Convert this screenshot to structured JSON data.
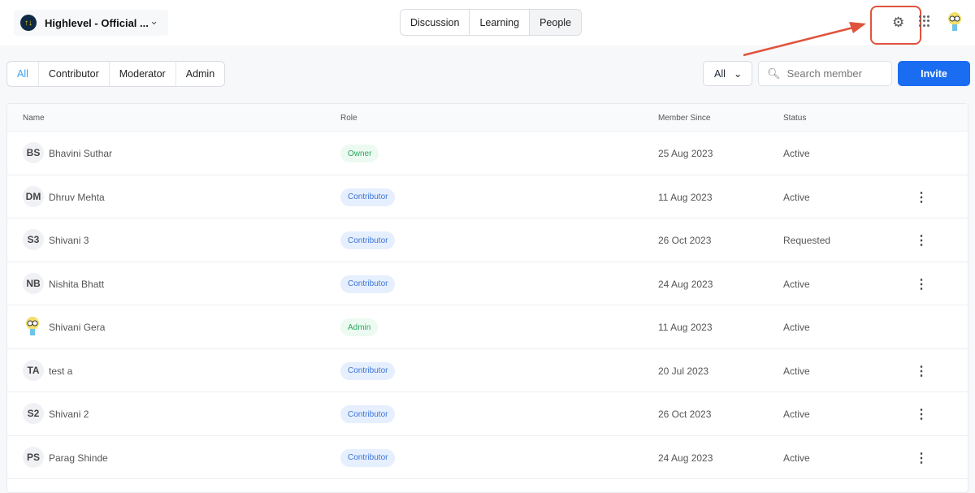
{
  "workspace": {
    "name": "Highlevel - Official ..."
  },
  "tabs": [
    "Discussion",
    "Learning",
    "People"
  ],
  "filters": [
    "All",
    "Contributor",
    "Moderator",
    "Admin"
  ],
  "status_select": "All",
  "search": {
    "placeholder": "Search member"
  },
  "invite_label": "Invite",
  "columns": [
    "Name",
    "Role",
    "Member Since",
    "Status"
  ],
  "members": [
    {
      "initials": "BS",
      "name": "Bhavini Suthar",
      "role": "Owner",
      "since": "25 Aug 2023",
      "status": "Active",
      "menu": false
    },
    {
      "initials": "DM",
      "name": "Dhruv Mehta",
      "role": "Contributor",
      "since": "11 Aug 2023",
      "status": "Active",
      "menu": true
    },
    {
      "initials": "S3",
      "name": "Shivani 3",
      "role": "Contributor",
      "since": "26 Oct 2023",
      "status": "Requested",
      "menu": true
    },
    {
      "initials": "NB",
      "name": "Nishita Bhatt",
      "role": "Contributor",
      "since": "24 Aug 2023",
      "status": "Active",
      "menu": true
    },
    {
      "initials": "",
      "name": "Shivani Gera",
      "role": "Admin",
      "since": "11 Aug 2023",
      "status": "Active",
      "menu": false
    },
    {
      "initials": "TA",
      "name": "test a",
      "role": "Contributor",
      "since": "20 Jul 2023",
      "status": "Active",
      "menu": true
    },
    {
      "initials": "S2",
      "name": "Shivani 2",
      "role": "Contributor",
      "since": "26 Oct 2023",
      "status": "Active",
      "menu": true
    },
    {
      "initials": "PS",
      "name": "Parag Shinde",
      "role": "Contributor",
      "since": "24 Aug 2023",
      "status": "Active",
      "menu": true
    }
  ],
  "colors": {
    "accent": "#1a6cf0",
    "highlight": "#e0533d"
  }
}
